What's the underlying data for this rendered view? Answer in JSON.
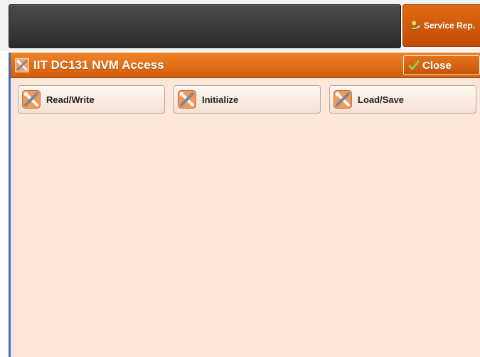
{
  "header": {
    "service_button_label": "Service Rep."
  },
  "panel": {
    "title": "IIT DC131 NVM Access",
    "close_label": "Close",
    "buttons": [
      {
        "label": "Read/Write",
        "icon": "tools-icon"
      },
      {
        "label": "Initialize",
        "icon": "tools-icon"
      },
      {
        "label": "Load/Save",
        "icon": "tools-icon"
      }
    ]
  },
  "colors": {
    "accent_orange": "#d45c0b",
    "panel_bg": "#fde7da",
    "left_border_blue": "#3e6fb6"
  }
}
